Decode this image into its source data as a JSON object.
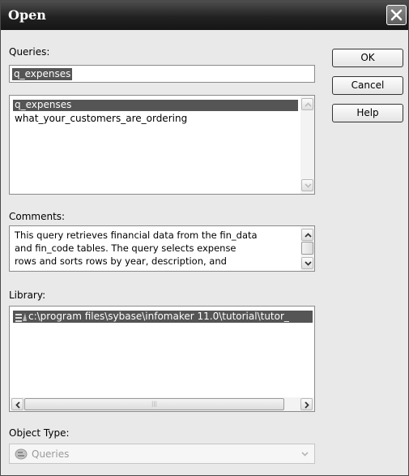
{
  "window": {
    "title": "Open"
  },
  "queries": {
    "label": "Queries:",
    "value": "q_expenses",
    "items": [
      "q_expenses",
      "what_your_customers_are_ordering"
    ],
    "selected_index": 0
  },
  "buttons": {
    "ok": "OK",
    "cancel": "Cancel",
    "help": "Help"
  },
  "comments": {
    "label": "Comments:",
    "lines": [
      "This query retrieves financial data from the fin_data",
      "and fin_code tables. The query selects expense",
      "rows and sorts rows by year, description, and"
    ]
  },
  "library": {
    "label": "Library:",
    "path": "c:\\program files\\sybase\\infomaker 11.0\\tutorial\\tutor_"
  },
  "object_type": {
    "label": "Object Type:",
    "value": "Queries"
  },
  "icons": {
    "close": "close-icon",
    "library": "library-icon",
    "object_type": "queries-icon",
    "dropdown": "chevron-down-icon"
  }
}
